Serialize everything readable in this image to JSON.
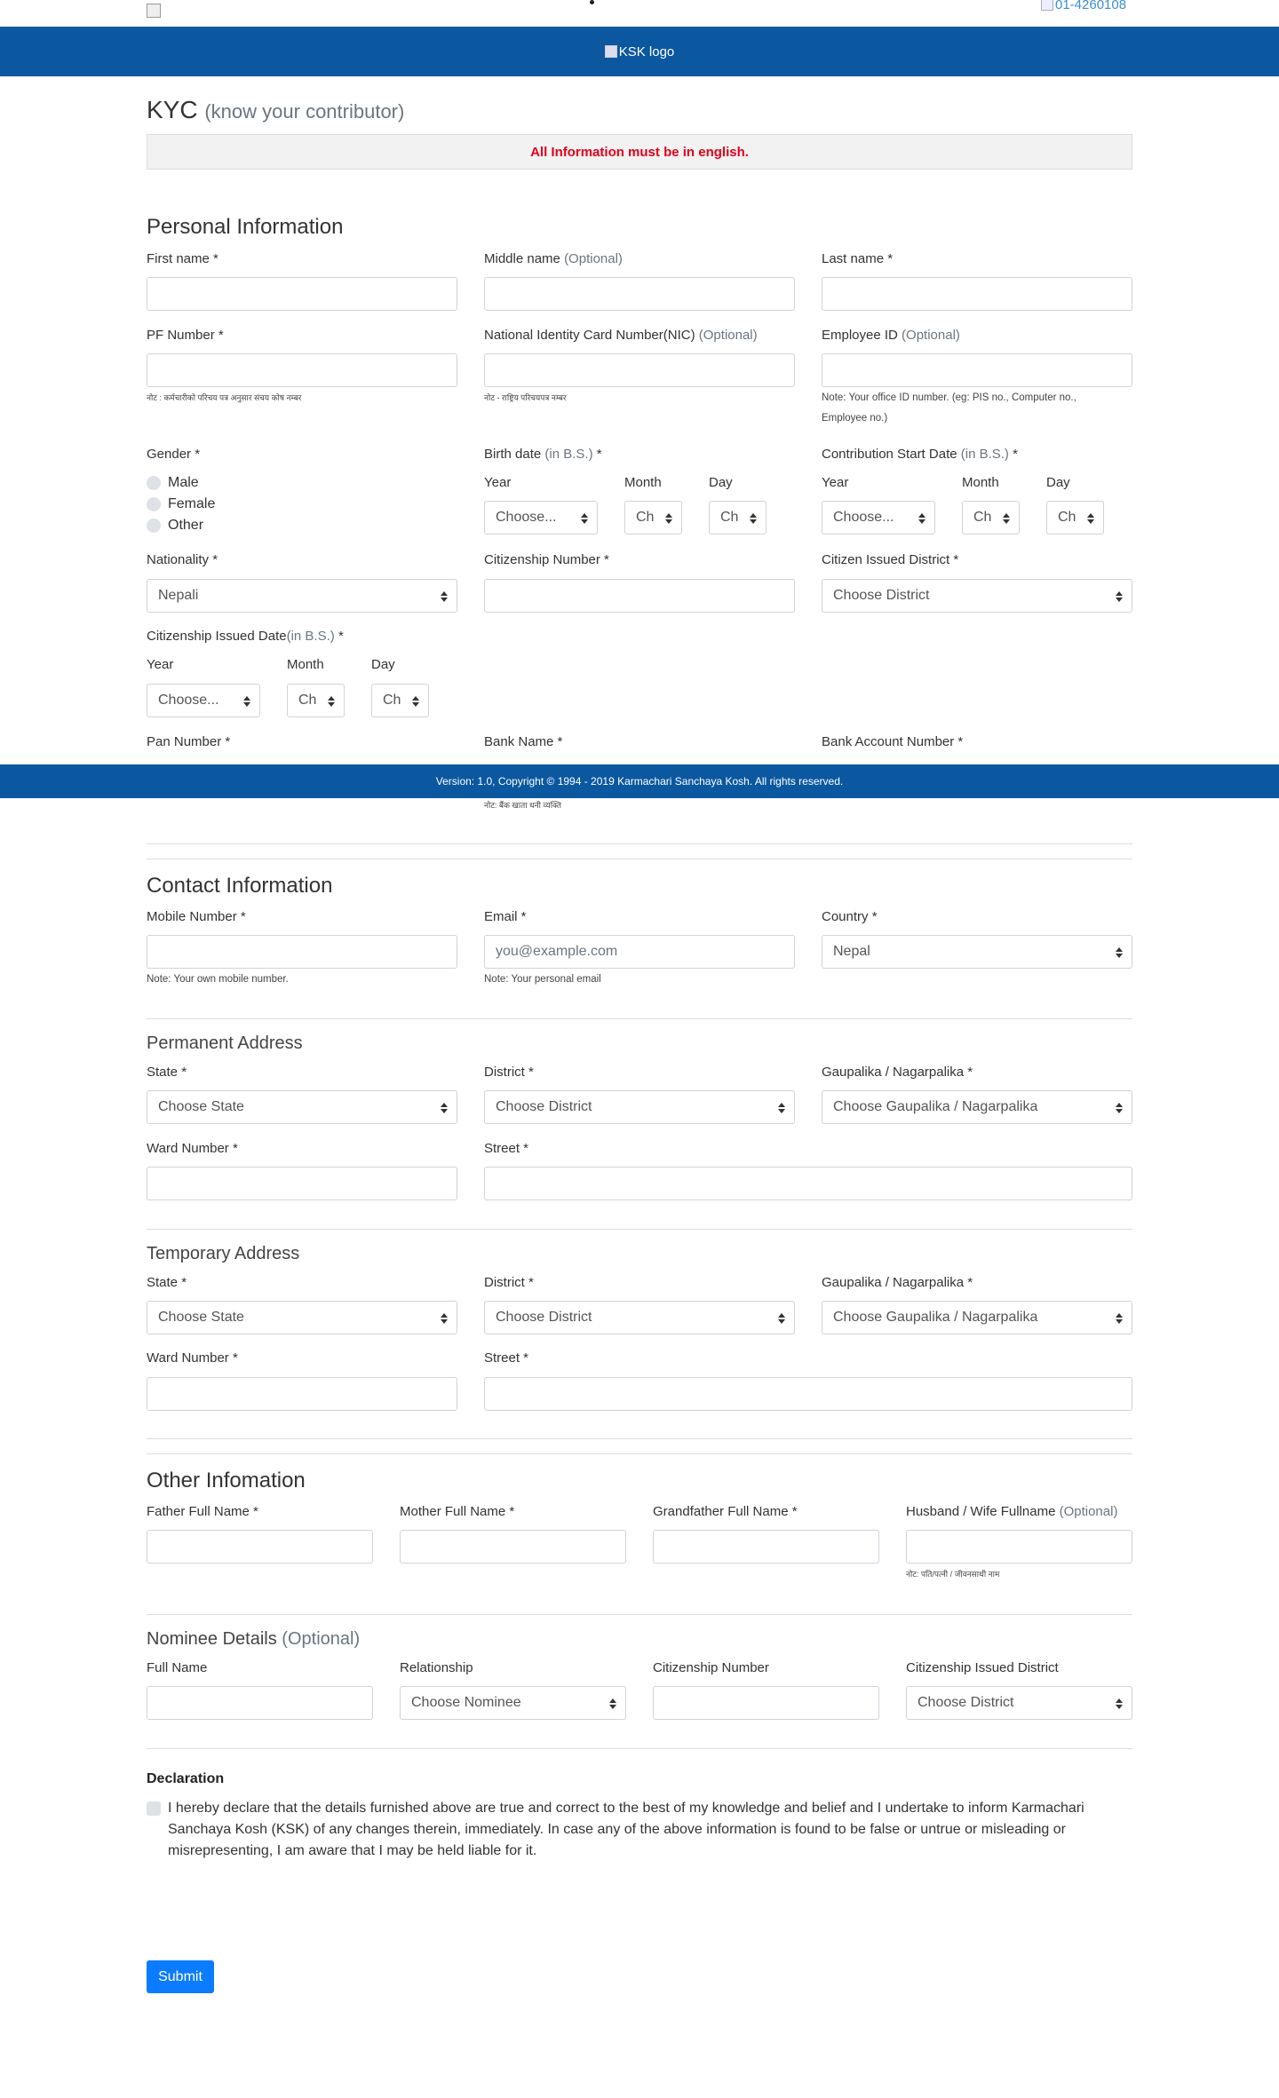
{
  "header": {
    "phone": "01-4260108",
    "logo_alt": "KSK logo"
  },
  "title": {
    "main": "KYC",
    "sub": "(know your contributor)"
  },
  "alert": "All Information must be in english.",
  "personal": {
    "heading": "Personal Information",
    "first_name": "First name *",
    "middle_name": "Middle name",
    "optional": "(Optional)",
    "last_name": "Last name *",
    "pf_number": "PF Number *",
    "pf_note": "नोट : कर्मचारीको परिचय पत्र अनुसार संचय कोष नम्बर",
    "nic": "National Identity Card Number(NIC)",
    "nic_note": "नोट - राष्ट्रिय परिचयपत्र नम्बर",
    "employee_id": "Employee ID",
    "employee_note_1": "Note: Your office ID number. (eg: PIS no., Computer no.,",
    "employee_note_2": "Employee no.)",
    "gender": "Gender *",
    "genders": [
      "Male",
      "Female",
      "Other"
    ],
    "birth_date": "Birth date",
    "in_bs": "(in B.S.)",
    "star": "*",
    "contrib_start": "Contribution Start Date",
    "year": "Year",
    "month": "Month",
    "day": "Day",
    "choose": "Choose...",
    "ch": "Ch",
    "nationality": "Nationality *",
    "nationality_value": "Nepali",
    "citizenship_number": "Citizenship Number *",
    "citizen_district": "Citizen Issued District *",
    "choose_district": "Choose District",
    "citizenship_date": "Citizenship Issued Date",
    "in_bs_nospace": "(in B.S.)",
    "pan": "Pan Number *",
    "bank_name": "Bank Name *",
    "bank_account": "Bank Account Number *",
    "bank_note": "नोट: बैंक खाता धनी व्यक्ति"
  },
  "footer": "Version: 1.0, Copyright © 1994 - 2019 Karmachari Sanchaya Kosh. All rights reserved.",
  "contact": {
    "heading": "Contact Information",
    "mobile": "Mobile Number *",
    "mobile_note": "Note: Your own mobile number.",
    "email": "Email *",
    "email_placeholder": "you@example.com",
    "email_note": "Note: Your personal email",
    "country": "Country *",
    "country_value": "Nepal"
  },
  "permanent": {
    "heading": "Permanent Address",
    "state": "State *",
    "choose_state": "Choose State",
    "district": "District *",
    "choose_district": "Choose District",
    "gaupalika": "Gaupalika / Nagarpalika *",
    "choose_gaupalika": "Choose Gaupalika / Nagarpalika",
    "ward": "Ward Number *",
    "street": "Street *"
  },
  "temporary": {
    "heading": "Temporary Address",
    "state": "State *",
    "choose_state": "Choose State",
    "district": "District *",
    "choose_district": "Choose District",
    "gaupalika": "Gaupalika / Nagarpalika *",
    "choose_gaupalika": "Choose Gaupalika / Nagarpalika",
    "ward": "Ward Number *",
    "street": "Street *"
  },
  "other": {
    "heading": "Other Infomation",
    "father": "Father Full Name *",
    "mother": "Mother Full Name *",
    "grandfather": "Grandfather Full Name *",
    "spouse": "Husband / Wife Fullname",
    "optional": "(Optional)",
    "spouse_note": "नोट: पति/पत्नी / जीवनसाथी नाम"
  },
  "nominee": {
    "heading": "Nominee Details",
    "optional": "(Optional)",
    "full_name": "Full Name",
    "relationship": "Relationship",
    "choose_nominee": "Choose Nominee",
    "citizenship_number": "Citizenship Number",
    "citizenship_district": "Citizenship Issued District",
    "choose_district": "Choose District"
  },
  "declaration": {
    "title": "Declaration",
    "text": "I hereby declare that the details furnished above are true and correct to the best of my knowledge and belief and I undertake to inform Karmachari Sanchaya Kosh (KSK) of any changes therein, immediately. In case any of the above information is found to be false or untrue or misleading or misrepresenting, I am aware that I may be held liable for it."
  },
  "submit": "Submit"
}
